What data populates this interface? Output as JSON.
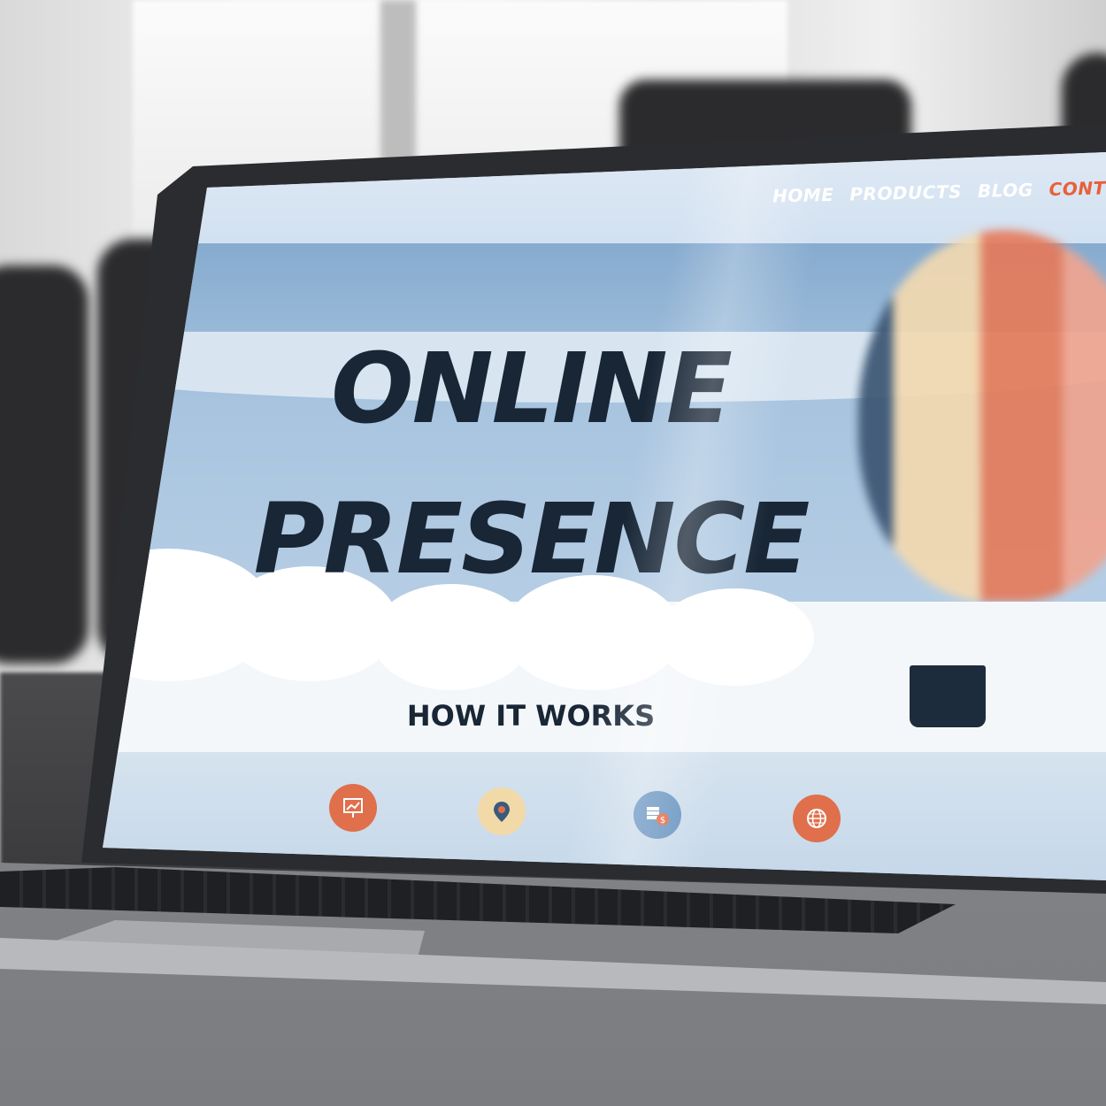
{
  "screen": {
    "nav": {
      "home": "HOME",
      "products": "PRODUCTS",
      "blog": "BLOG",
      "contact_partial": "CONT"
    },
    "hero": {
      "title_line1": "ONLINE",
      "title_line2": "PRESENCE"
    },
    "section_heading": "HOW IT WORKS",
    "icons": [
      "presentation-chart-icon",
      "location-pin-icon",
      "coins-dollar-icon",
      "globe-icon"
    ]
  },
  "colors": {
    "accent": "#e8603a",
    "title_text": "#182636",
    "hero_blue": "#a8c4df"
  }
}
